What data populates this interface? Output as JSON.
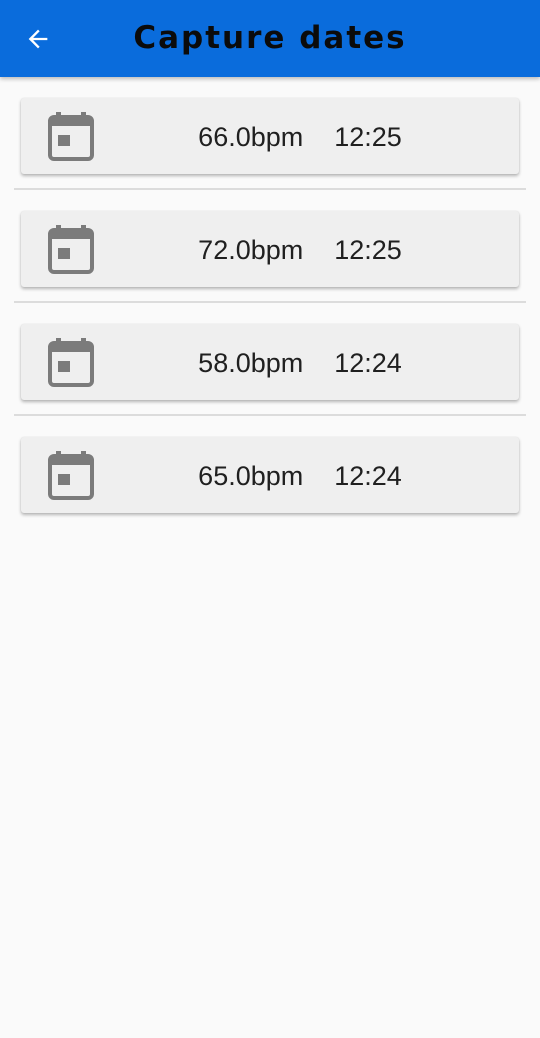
{
  "app_bar": {
    "title": "Capture dates",
    "back_icon": "arrow-back-icon",
    "color": "#0a6cdc"
  },
  "captures": [
    {
      "icon": "calendar-icon",
      "text": "66.0bpm  12:25"
    },
    {
      "icon": "calendar-icon",
      "text": "72.0bpm  12:25"
    },
    {
      "icon": "calendar-icon",
      "text": "58.0bpm  12:24"
    },
    {
      "icon": "calendar-icon",
      "text": "65.0bpm  12:24"
    }
  ]
}
